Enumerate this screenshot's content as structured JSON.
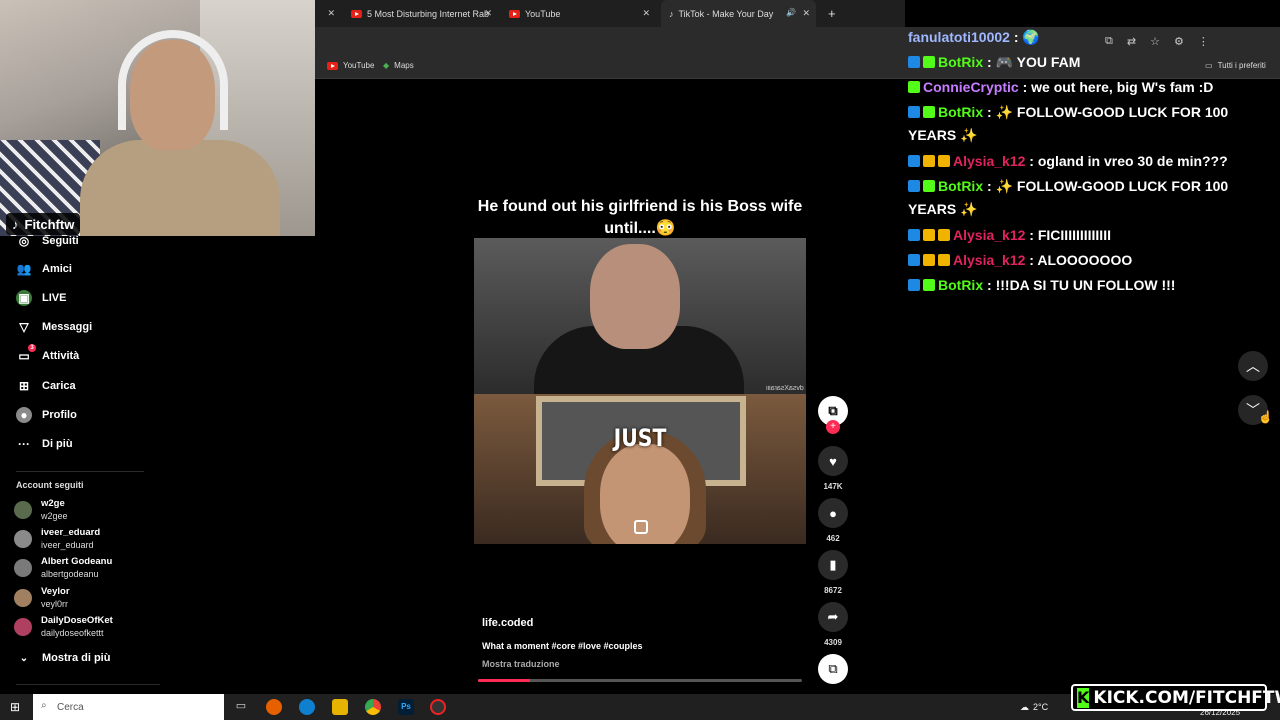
{
  "browser": {
    "tabs": [
      {
        "label": "5 Most Disturbing Internet Rab"
      },
      {
        "label": "YouTube"
      },
      {
        "label": "TikTok - Make Your Day"
      }
    ],
    "bookmarks": [
      "YouTube",
      "Maps"
    ],
    "all_bookmarks": "Tutti i preferiti"
  },
  "stream": {
    "channel": "Fitchftw",
    "kick_banner": "KICK.COM/FITCHFTW"
  },
  "sidebar": {
    "nav": [
      {
        "label": "Seguiti",
        "icon": "following-icon"
      },
      {
        "label": "Amici",
        "icon": "friends-icon"
      },
      {
        "label": "LIVE",
        "icon": "live-icon"
      },
      {
        "label": "Messaggi",
        "icon": "messages-icon"
      },
      {
        "label": "Attività",
        "icon": "activity-icon",
        "badge": "3"
      },
      {
        "label": "Carica",
        "icon": "upload-icon"
      },
      {
        "label": "Profilo",
        "icon": "profile-icon"
      },
      {
        "label": "Di più",
        "icon": "more-icon"
      }
    ],
    "followed_title": "Account seguiti",
    "followed": [
      {
        "name": "w2ge",
        "handle": "w2gee",
        "color": "#5a6b4d"
      },
      {
        "name": "iveer_eduard",
        "handle": "iveer_eduard",
        "color": "#8a8a8a"
      },
      {
        "name": "Albert Godeanu",
        "handle": "albertgodeanu",
        "color": "#7a7a7a"
      },
      {
        "name": "Veylor",
        "handle": "veyl0rr",
        "color": "#a08060"
      },
      {
        "name": "DailyDoseOfKet",
        "handle": "dailydoseofkettt",
        "color": "#b04060"
      }
    ],
    "show_more": "Mostra di più"
  },
  "video": {
    "caption": "He found out his girlfriend is his Boss wife until....😳",
    "overlay_word": "JUST",
    "watermark": "dvsaXsaraiii",
    "author": "life.coded",
    "description": "What a moment #core #love #couples",
    "translate": "Mostra traduzione",
    "progress": 0.16,
    "actions": {
      "likes": "147K",
      "comments": "462",
      "saves": "8672",
      "shares": "4309"
    }
  },
  "chat": {
    "messages": [
      {
        "user": "fanulatoti10002",
        "user_color": "#9fb8ff",
        "text": "🌍",
        "badges": []
      },
      {
        "user": "BotRix",
        "user_color": "#53fc18",
        "text": "🎮 YOU FAM",
        "badges": [
          "#1e88e5",
          "#53fc18"
        ]
      },
      {
        "user": "ConnieCryptic",
        "user_color": "#c77dff",
        "text": "we out here, big W's fam :D",
        "badges": [
          "#53fc18"
        ]
      },
      {
        "user": "BotRix",
        "user_color": "#53fc18",
        "text": "✨ FOLLOW-GOOD LUCK FOR 100 YEARS ✨",
        "badges": [
          "#1e88e5",
          "#53fc18"
        ]
      },
      {
        "user": "Alysia_k12",
        "user_color": "#e0245e",
        "text": "ogland in vreo 30 de min???",
        "badges": [
          "#1e88e5",
          "#f0b400",
          "#f0b400"
        ]
      },
      {
        "user": "BotRix",
        "user_color": "#53fc18",
        "text": "✨ FOLLOW-GOOD LUCK FOR 100 YEARS ✨",
        "badges": [
          "#1e88e5",
          "#53fc18"
        ]
      },
      {
        "user": "Alysia_k12",
        "user_color": "#e0245e",
        "text": "FICIIIIIIIIIIIII",
        "badges": [
          "#1e88e5",
          "#f0b400",
          "#f0b400"
        ]
      },
      {
        "user": "Alysia_k12",
        "user_color": "#e0245e",
        "text": "ALOOOOOOO",
        "badges": [
          "#1e88e5",
          "#f0b400",
          "#f0b400"
        ]
      },
      {
        "user": "BotRix",
        "user_color": "#53fc18",
        "text": "!!!DA SI TU UN FOLLOW !!!",
        "badges": [
          "#1e88e5",
          "#53fc18"
        ]
      }
    ]
  },
  "taskbar": {
    "search_placeholder": "Cerca",
    "weather": "2°C",
    "date": "26/12/2025"
  }
}
